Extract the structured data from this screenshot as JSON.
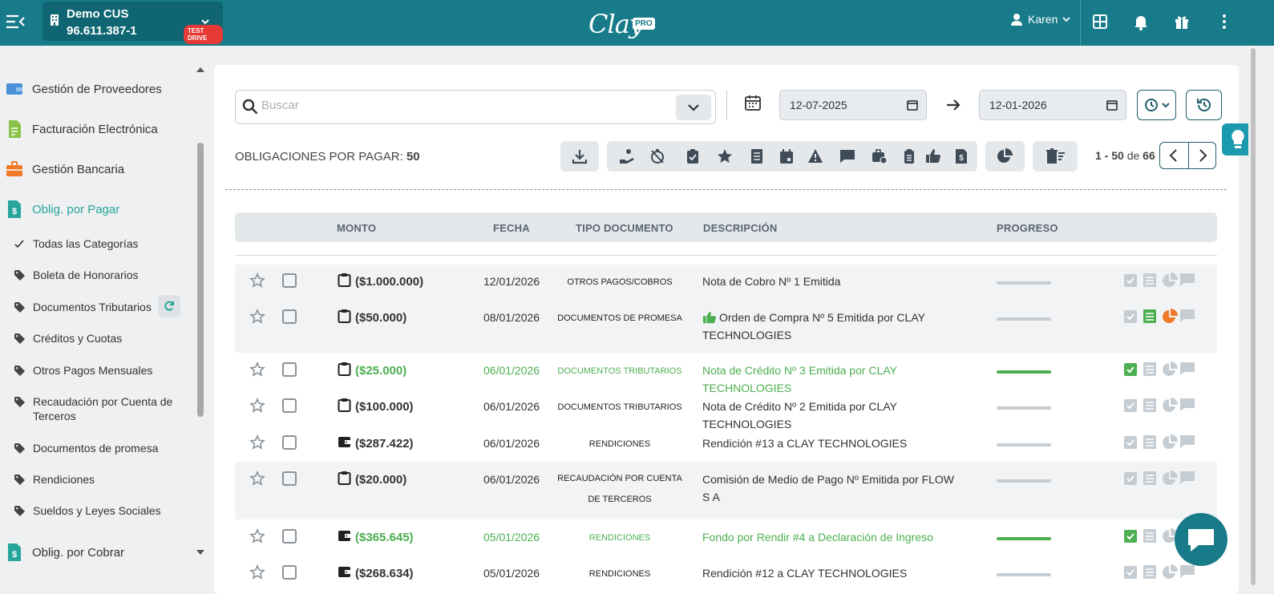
{
  "topbar": {
    "company_name": "Demo CUS",
    "company_rut": "96.611.387-1",
    "badge": "TEST DRIVE",
    "logo_word": "Clay",
    "logo_badge": "PRO",
    "user": "Karen"
  },
  "sidebar": {
    "main": [
      {
        "label": "Gestión de Proveedores",
        "icon": "wallet-icon",
        "color": "#4a90d9"
      },
      {
        "label": "Facturación Electrónica",
        "icon": "invoice-icon",
        "color": "#8bc34a"
      },
      {
        "label": "Gestión Bancaria",
        "icon": "briefcase-icon",
        "color": "#f07a2a"
      },
      {
        "label": "Oblig. por Pagar",
        "icon": "document-dollar-icon",
        "color": "#26a69a"
      },
      {
        "label": "Oblig. por Cobrar",
        "icon": "document-dollar-icon",
        "color": "#26a69a"
      }
    ],
    "all_categories": "Todas las Categorías",
    "categories": [
      "Boleta de Honorarios",
      "Documentos Tributarios",
      "Créditos y Cuotas",
      "Otros Pagos Mensuales",
      "Recaudación por Cuenta de Terceros",
      "Documentos de promesa",
      "Rendiciones",
      "Sueldos y Leyes Sociales"
    ]
  },
  "filters": {
    "search_placeholder": "Buscar",
    "date_from": "12-07-2025",
    "date_to": "12-01-2026"
  },
  "list": {
    "heading_label": "OBLIGACIONES POR PAGAR:",
    "heading_count": "50",
    "range": "1 - 50",
    "range_of": "de",
    "range_total": "66"
  },
  "table": {
    "headers": {
      "monto": "MONTO",
      "fecha": "FECHA",
      "tipo": "TIPO DOCUMENTO",
      "descripcion": "DESCRIPCIÓN",
      "progreso": "PROGRESO"
    },
    "rows": [
      {
        "amount": "($1.000.000)",
        "date": "12/01/2026",
        "type": "OTROS PAGOS/COBROS",
        "desc": "Nota de Cobro Nº 1 Emitida",
        "progress": 0,
        "paid": false
      },
      {
        "amount": "($50.000)",
        "date": "08/01/2026",
        "type": "DOCUMENTOS DE PROMESA",
        "desc": "Orden de Compra Nº 5 Emitida por CLAY TECHNOLOGIES",
        "progress": 0,
        "paid": false
      },
      {
        "amount": "($25.000)",
        "date": "06/01/2026",
        "type": "DOCUMENTOS TRIBUTARIOS",
        "desc": "Nota de Crédito Nº 3 Emitida por CLAY TECHNOLOGIES",
        "progress": 1,
        "paid": true
      },
      {
        "amount": "($100.000)",
        "date": "06/01/2026",
        "type": "DOCUMENTOS TRIBUTARIOS",
        "desc": "Nota de Crédito Nº 2 Emitida por CLAY TECHNOLOGIES",
        "progress": 0,
        "paid": false
      },
      {
        "amount": "($287.422)",
        "date": "06/01/2026",
        "type": "RENDICIONES",
        "desc": "Rendición #13 a CLAY TECHNOLOGIES",
        "progress": 0,
        "paid": false
      },
      {
        "amount": "($20.000)",
        "date": "06/01/2026",
        "type": "RECAUDACIÓN POR CUENTA DE TERCEROS",
        "desc": "Comisión de Medio de Pago Nº Emitida por FLOW S A",
        "progress": 0,
        "paid": false
      },
      {
        "amount": "($365.645)",
        "date": "05/01/2026",
        "type": "RENDICIONES",
        "desc": "Fondo por Rendir #4 a Declaración de Ingreso",
        "progress": 1,
        "paid": true
      },
      {
        "amount": "($268.634)",
        "date": "05/01/2026",
        "type": "RENDICIONES",
        "desc": "Rendición #12 a CLAY TECHNOLOGIES",
        "progress": 0,
        "paid": false
      }
    ]
  },
  "colors": {
    "primary": "#177b8a",
    "paid": "#4caf50",
    "warning": "#f07a2a"
  }
}
